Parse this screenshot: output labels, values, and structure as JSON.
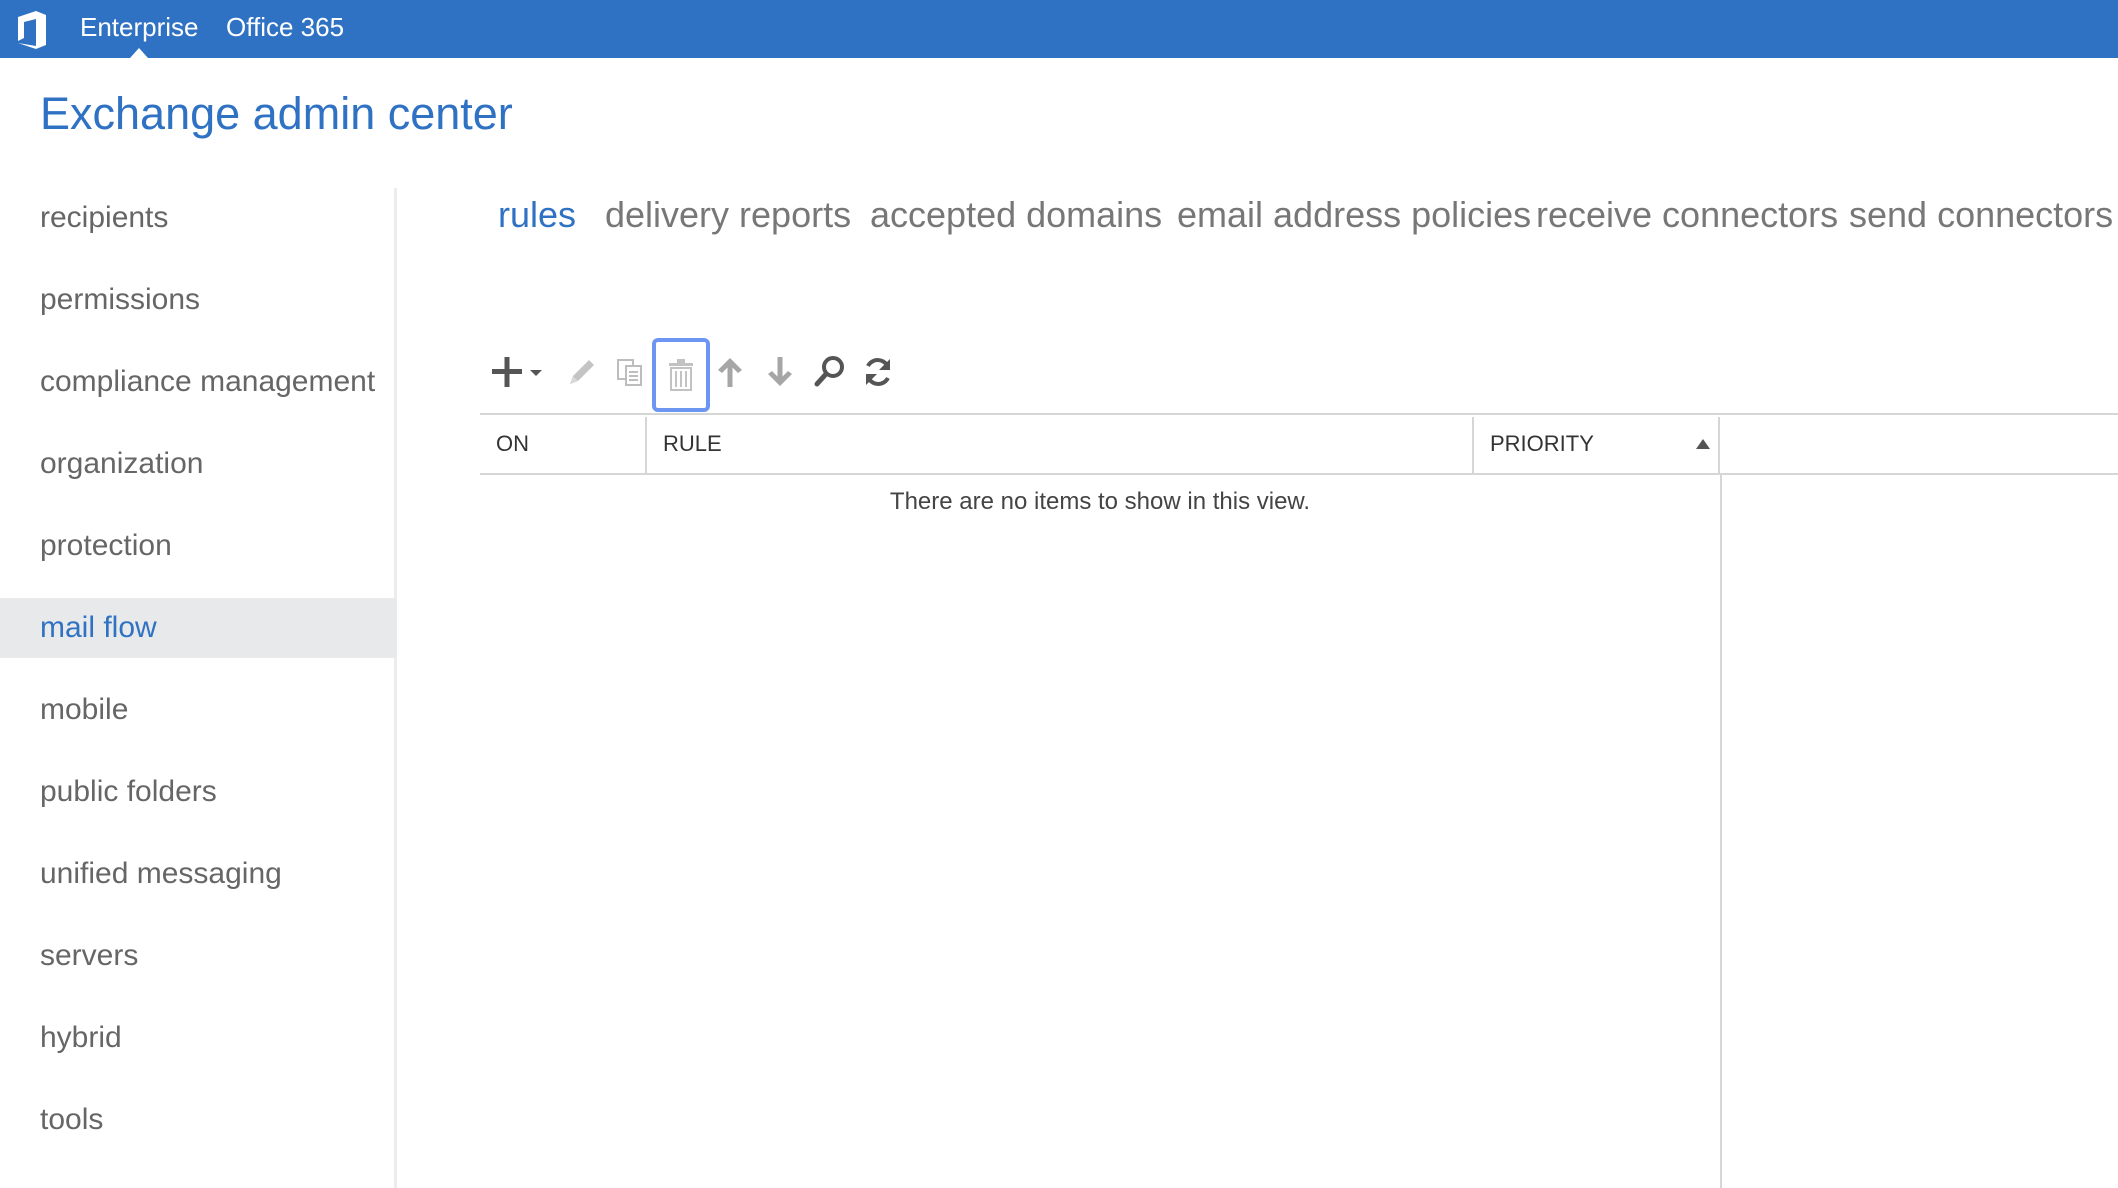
{
  "topbar": {
    "logo_icon": "office-logo-icon",
    "links": [
      "Enterprise",
      "Office 365"
    ],
    "active_link": "Enterprise",
    "color": "#2f72c3"
  },
  "app_title": "Exchange admin center",
  "nav": {
    "items": [
      "recipients",
      "permissions",
      "compliance management",
      "organization",
      "protection",
      "mail flow",
      "mobile",
      "public folders",
      "unified messaging",
      "servers",
      "hybrid",
      "tools"
    ],
    "selected": "mail flow"
  },
  "tabs": {
    "items": [
      "rules",
      "delivery reports",
      "accepted domains",
      "email address policies",
      "receive connectors",
      "send connectors"
    ],
    "active": "rules"
  },
  "toolbar": {
    "icons": [
      "add-icon",
      "edit-icon",
      "copy-icon",
      "delete-icon",
      "move-up-icon",
      "move-down-icon",
      "search-icon",
      "refresh-icon"
    ],
    "focused": "delete-icon"
  },
  "grid": {
    "columns": [
      "ON",
      "RULE",
      "PRIORITY"
    ],
    "sort_column": "PRIORITY",
    "sort_direction": "ascending",
    "empty_message": "There are no items to show in this view."
  }
}
